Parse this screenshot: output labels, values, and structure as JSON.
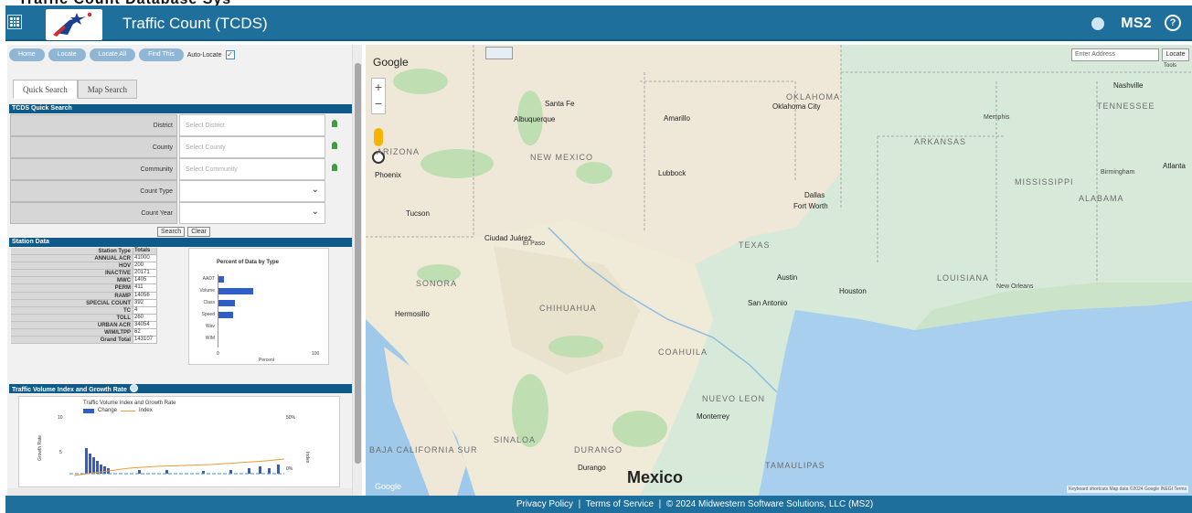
{
  "header": {
    "app_title": "Traffic Count (TCDS)",
    "brand": "MS2",
    "help_icon": "?",
    "title_fragment": "Traffic Count Database Sys"
  },
  "left_panel": {
    "toolbar": {
      "buttons": [
        "Home",
        "Locate",
        "Locate All",
        "Find This"
      ],
      "auto_locate_label": "Auto-Locate",
      "auto_locate_checked": true
    },
    "tabs": [
      "Quick Search",
      "Map Search"
    ],
    "active_tab": "Quick Search",
    "quick_search": {
      "header": "TCDS Quick Search",
      "rows": [
        {
          "label": "District",
          "placeholder": "Select District"
        },
        {
          "label": "County",
          "placeholder": "Select County"
        },
        {
          "label": "Community",
          "placeholder": "Select Community"
        }
      ],
      "select_rows": [
        {
          "label": "Count Type",
          "value": ""
        },
        {
          "label": "Count Year",
          "value": ""
        }
      ],
      "search_label": "Search",
      "clear_label": "Clear"
    },
    "station_data": {
      "header": "Station Data",
      "column_headers": [
        "Station Type",
        "Totals"
      ],
      "rows": [
        {
          "type": "ANNUAL ACR",
          "total": "41000"
        },
        {
          "type": "HOV",
          "total": "200"
        },
        {
          "type": "INACTIVE",
          "total": "20171"
        },
        {
          "type": "MWC",
          "total": "1405"
        },
        {
          "type": "PERM",
          "total": "411"
        },
        {
          "type": "RAMP",
          "total": "14056"
        },
        {
          "type": "SPECIAL COUNT",
          "total": "392"
        },
        {
          "type": "TC",
          "total": "4"
        },
        {
          "type": "TOLL",
          "total": "260"
        },
        {
          "type": "URBAN ACR",
          "total": "34054"
        },
        {
          "type": "WIM/LTPP",
          "total": "62"
        },
        {
          "type": "Grand Total",
          "total": "143107"
        }
      ],
      "chart": {
        "title": "Percent of Data by Type",
        "xlabel": "Percent",
        "tick_min": "0",
        "tick_max": "100",
        "categories": [
          "AADT",
          "Volume",
          "Class",
          "Speed",
          "Wav",
          "WIM"
        ],
        "values": [
          6,
          38,
          18,
          16,
          0,
          0
        ]
      }
    },
    "traffic_volume": {
      "header": "Traffic Volume Index and Growth Rate",
      "chart_title": "Traffic Volume Index and Growth Rate",
      "legend_change": "Change",
      "legend_index": "Index",
      "left_tick_top": "10",
      "left_tick_mid": "5",
      "right_tick_top": "50%",
      "right_tick_bottom": "0%",
      "left_axis_label": "Growth Rate",
      "right_axis_label": "Index"
    }
  },
  "map": {
    "google_label": "Google",
    "address_placeholder": "Enter Address",
    "locate_label": "Locate",
    "tools_label": "Tools",
    "big_label": "Mexico",
    "attribution": "Keyboard shortcuts   Map data ©2024 Google INEGI   Terms",
    "states": [
      {
        "name": "OKLAHOMA"
      },
      {
        "name": "ARKANSAS"
      },
      {
        "name": "TENNESSEE"
      },
      {
        "name": "MISSISSIPPI"
      },
      {
        "name": "ALABAMA"
      },
      {
        "name": "LOUISIANA"
      },
      {
        "name": "TEXAS"
      },
      {
        "name": "NEW MEXICO"
      },
      {
        "name": "ARIZONA"
      },
      {
        "name": "SONORA"
      },
      {
        "name": "CHIHUAHUA"
      },
      {
        "name": "COAHUILA"
      },
      {
        "name": "NUEVO LEON"
      },
      {
        "name": "DURANGO"
      },
      {
        "name": "SINALOA"
      },
      {
        "name": "BAJA CALIFORNIA SUR"
      },
      {
        "name": "TAMAULIPAS"
      }
    ],
    "cities": [
      {
        "name": "Oklahoma City"
      },
      {
        "name": "Albuquerque"
      },
      {
        "name": "Amarillo"
      },
      {
        "name": "Santa Fe"
      },
      {
        "name": "Lubbock"
      },
      {
        "name": "Dallas"
      },
      {
        "name": "Fort Worth"
      },
      {
        "name": "Tucson"
      },
      {
        "name": "Phoenix"
      },
      {
        "name": "Ciudad Juárez"
      },
      {
        "name": "Austin"
      },
      {
        "name": "San Antonio"
      },
      {
        "name": "Houston"
      },
      {
        "name": "Hermosillo"
      },
      {
        "name": "Monterrey"
      },
      {
        "name": "Nashville"
      },
      {
        "name": "Atlanta"
      },
      {
        "name": "Durango"
      },
      {
        "name": "Memphis"
      },
      {
        "name": "Birmingham"
      },
      {
        "name": "New Orleans"
      },
      {
        "name": "El Paso"
      }
    ]
  },
  "footer": {
    "privacy": "Privacy Policy",
    "terms": "Terms of Service",
    "copyright": "© 2024 Midwestern Software Solutions, LLC (MS2)",
    "sep": "|"
  }
}
